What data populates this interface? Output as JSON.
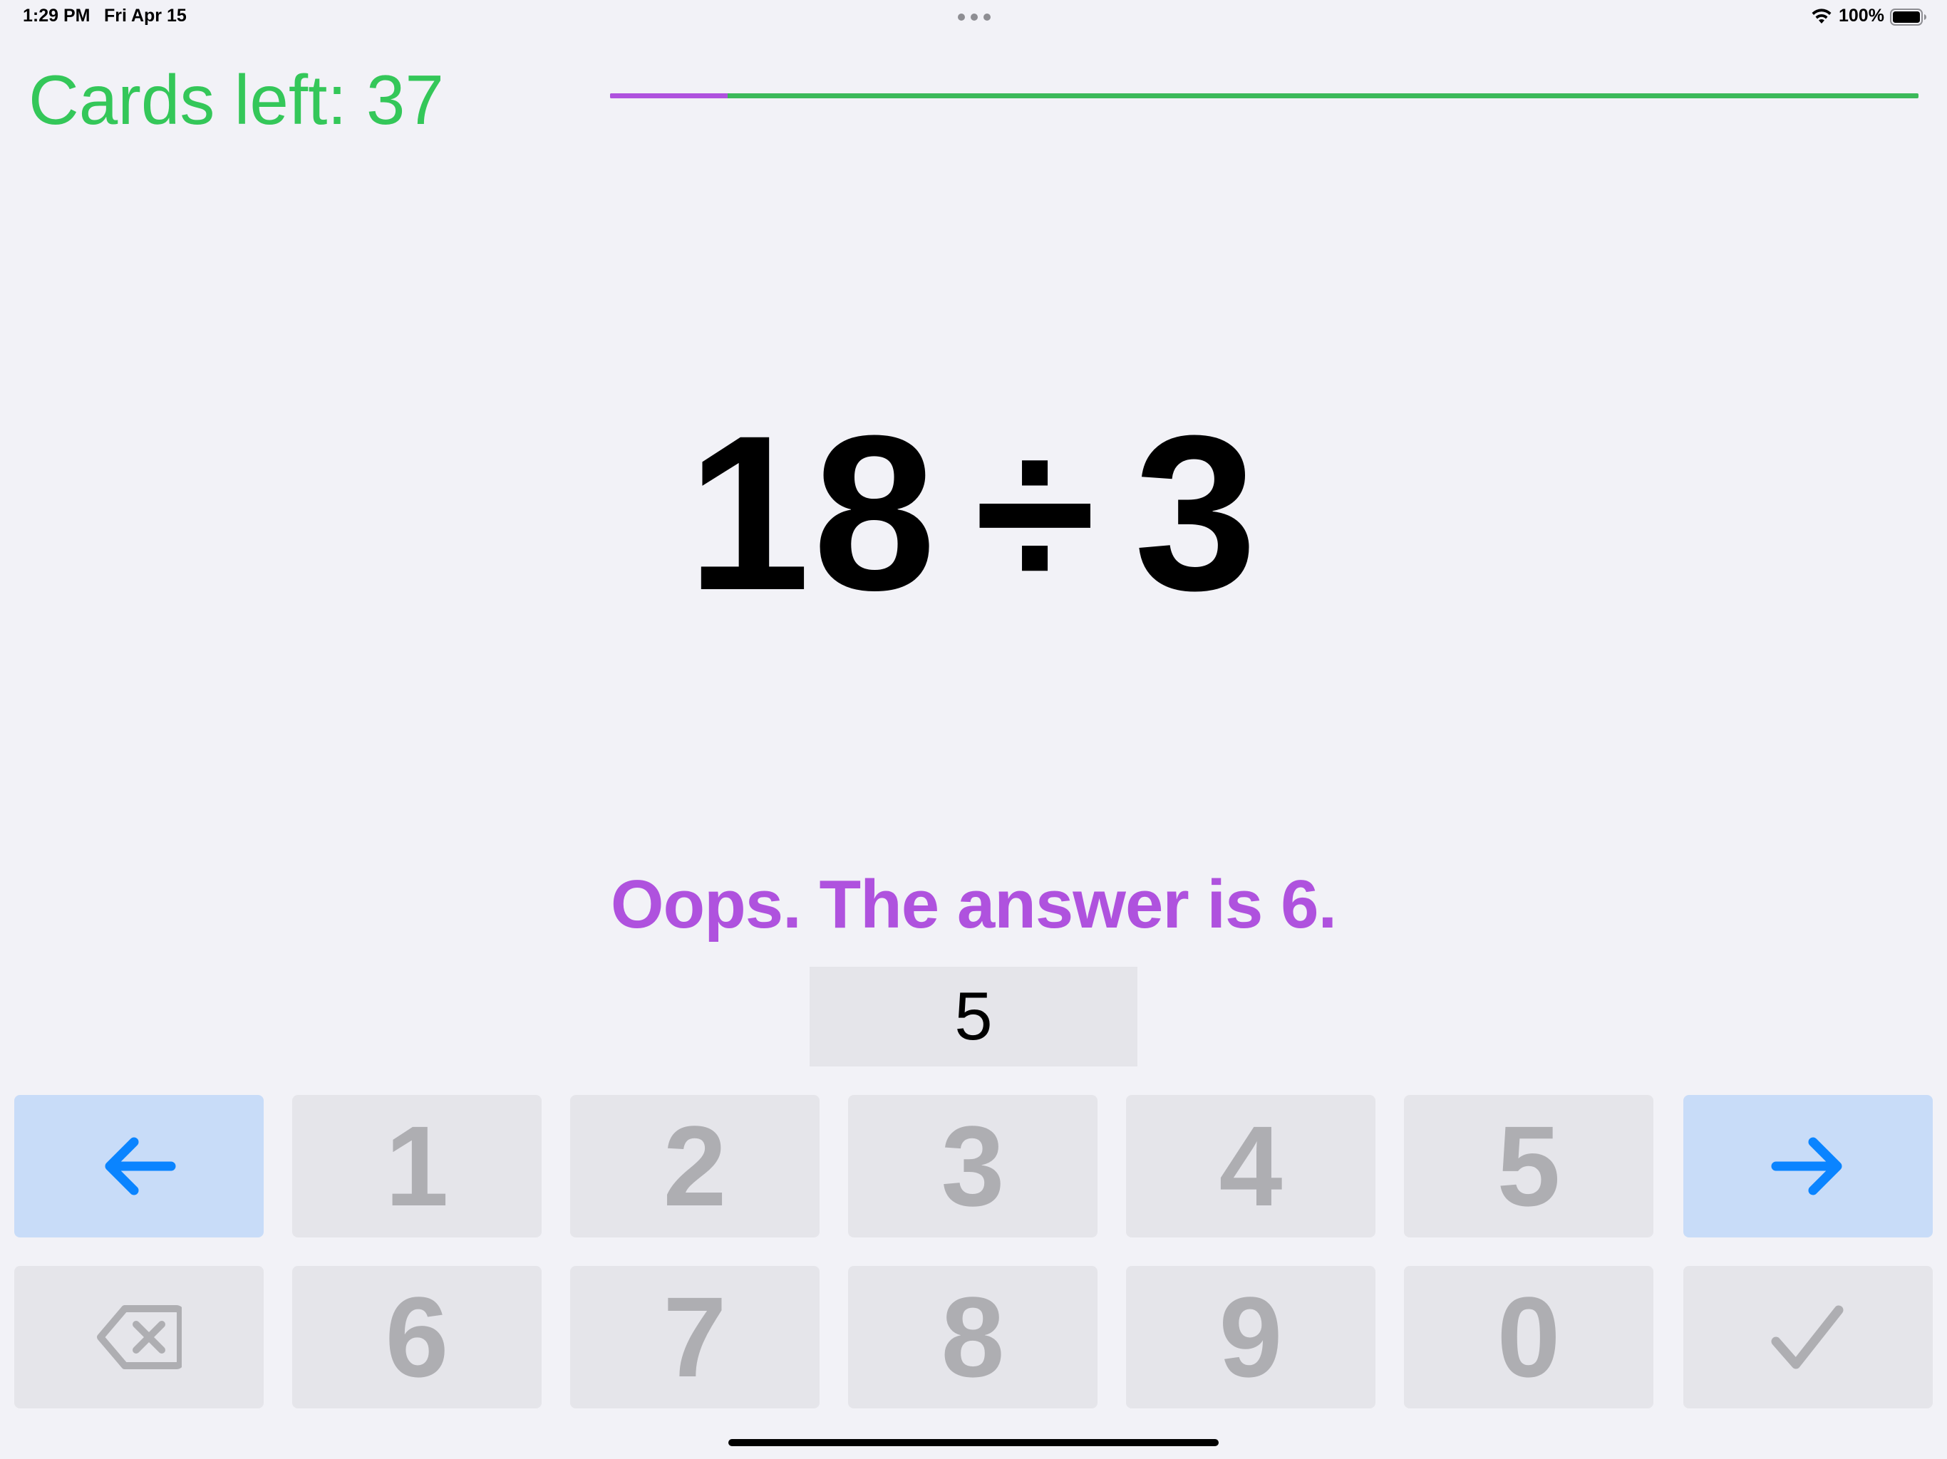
{
  "status_bar": {
    "time": "1:29 PM",
    "date": "Fri Apr 15",
    "battery": "100%"
  },
  "header": {
    "cards_left": "Cards left: 37",
    "progress_fraction": 0.09
  },
  "problem": {
    "left": "18",
    "operator": "÷",
    "right": "3"
  },
  "feedback": "Oops. The answer is 6.",
  "answer": "5",
  "keypad": {
    "row1": [
      "1",
      "2",
      "3",
      "4",
      "5"
    ],
    "row2": [
      "6",
      "7",
      "8",
      "9",
      "0"
    ],
    "icons": {
      "prev": "arrow-left-icon",
      "next": "arrow-right-icon",
      "delete": "delete-backspace-icon",
      "submit": "checkmark-icon"
    }
  },
  "colors": {
    "accent_green": "#34c759",
    "accent_purple": "#af52de",
    "nav_blue": "#0a84ff",
    "key_bg": "#e5e5ea",
    "key_text": "#aeaeb2"
  }
}
